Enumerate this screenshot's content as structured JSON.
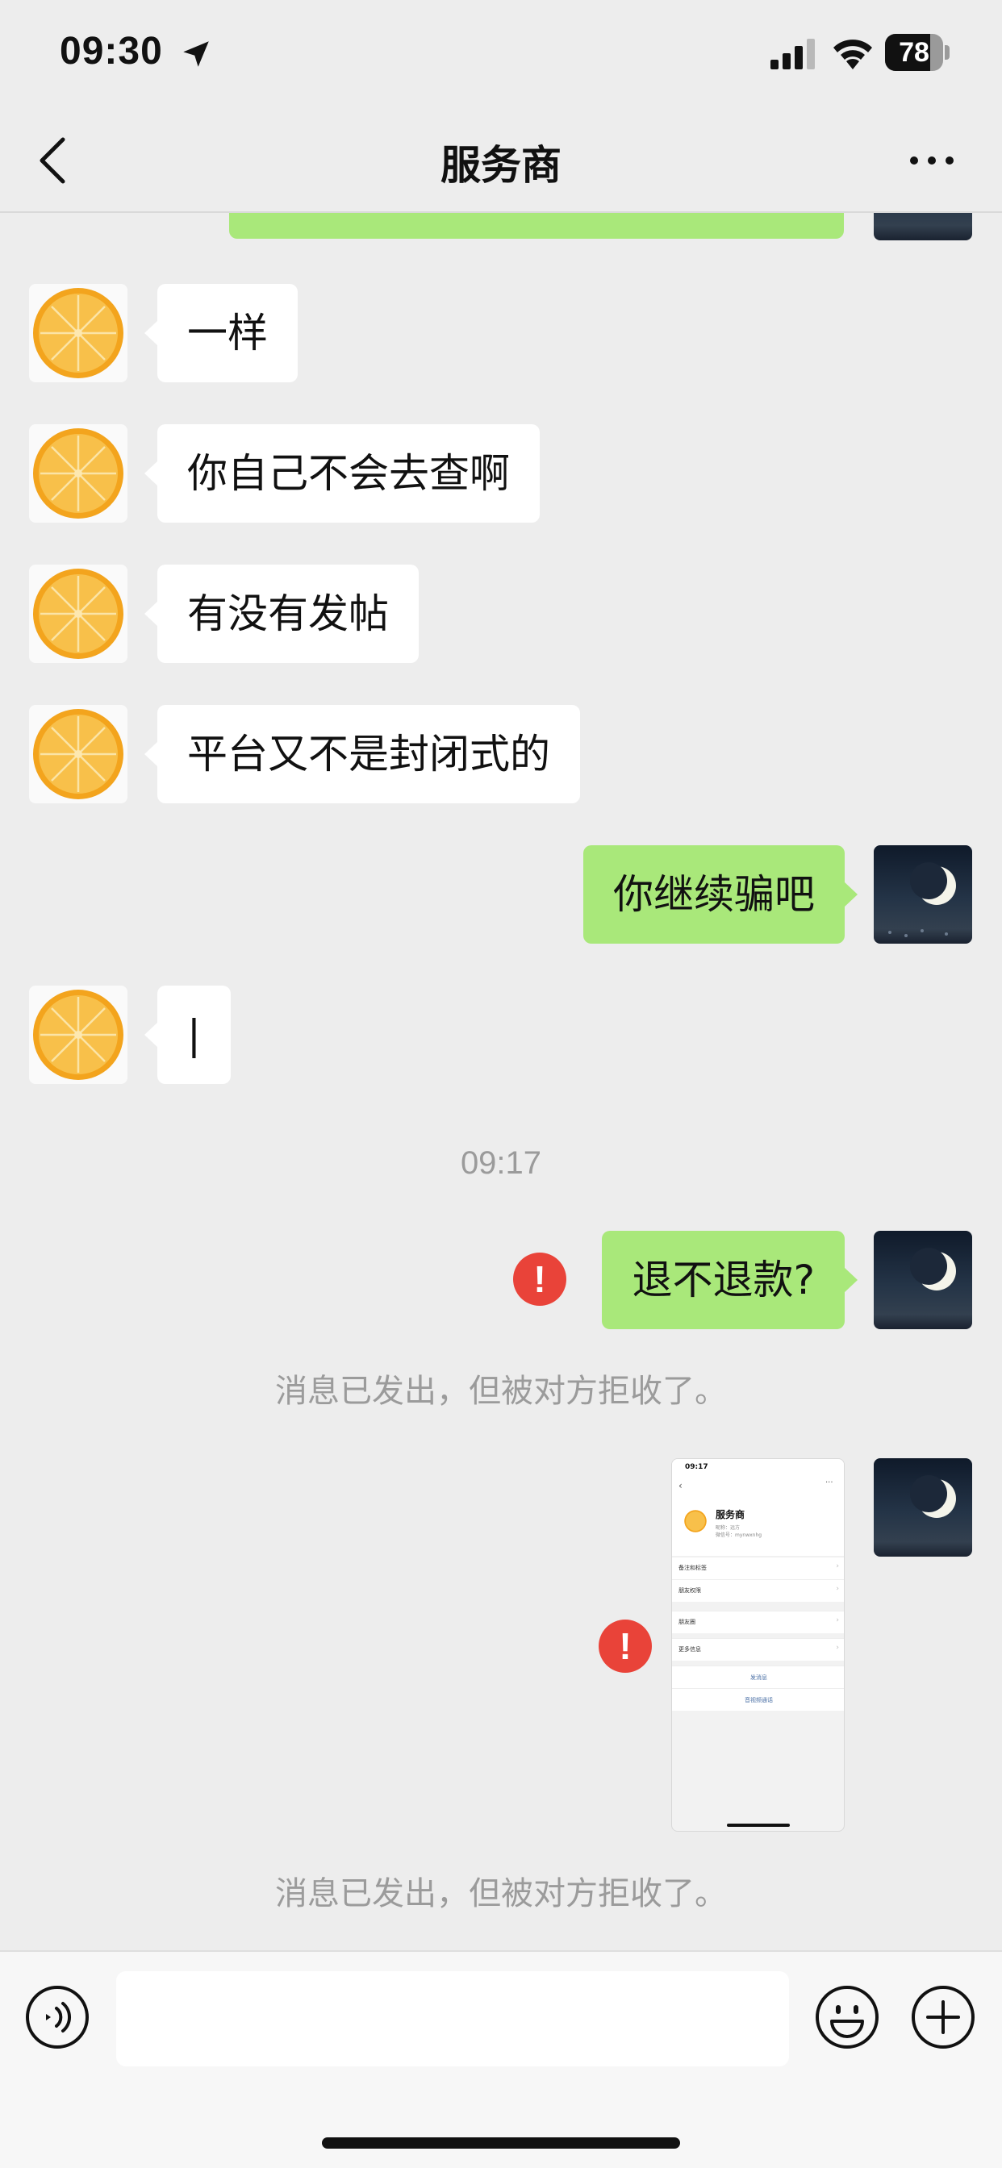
{
  "status_bar": {
    "time": "09:30",
    "battery": "78",
    "battery_level": 0.78,
    "icons": [
      "location-arrow-icon",
      "cellular-signal-icon",
      "wifi-icon",
      "battery-icon"
    ]
  },
  "nav": {
    "title": "服务商",
    "icons": [
      "back-chevron-icon",
      "more-dots-icon"
    ]
  },
  "messages": [
    {
      "from": "contact",
      "text": "一样"
    },
    {
      "from": "contact",
      "text": "你自己不会去查啊"
    },
    {
      "from": "contact",
      "text": "有没有发帖"
    },
    {
      "from": "contact",
      "text": "平台又不是封闭式的"
    },
    {
      "from": "me",
      "text": "你继续骗吧"
    },
    {
      "from": "contact",
      "text": "|"
    }
  ],
  "timestamp": "09:17",
  "failed_messages": [
    {
      "from": "me",
      "text": "退不退款?",
      "error_badge": "!",
      "note": "消息已发出，但被对方拒收了。"
    },
    {
      "from": "me",
      "type": "image",
      "error_badge": "!",
      "note": "消息已发出，但被对方拒收了。"
    }
  ],
  "screenshot_thumbnail": {
    "time": "09:17",
    "name": "服务商",
    "subline_1": "昵称：远方",
    "subline_2": "微信号：mynwxnhg",
    "rows": [
      "备注和标签",
      "朋友权限",
      "朋友圈",
      "更多信息"
    ],
    "actions": [
      "发消息",
      "音视频通话"
    ]
  },
  "input_bar": {
    "placeholder": "",
    "icons": [
      "voice-icon",
      "emoji-icon",
      "plus-icon"
    ]
  },
  "colors": {
    "background": "#ededed",
    "bubble_out": "#a9e87a",
    "bubble_in": "#ffffff",
    "error": "#e94339",
    "muted_text": "#9b9b9b"
  }
}
